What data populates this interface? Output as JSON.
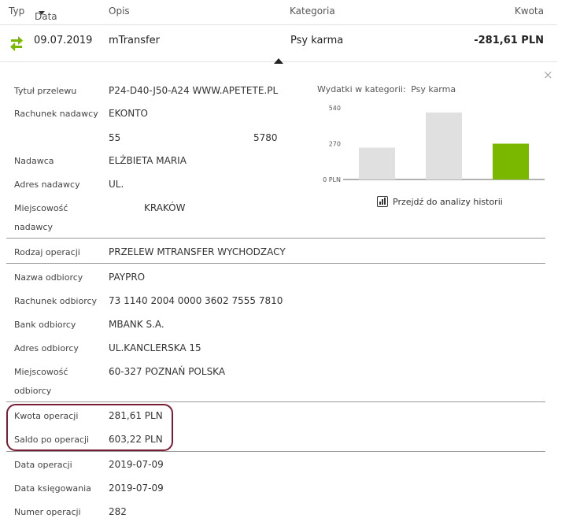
{
  "header": {
    "typ": "Typ",
    "data": "Data",
    "opis": "Opis",
    "kategoria": "Kategoria",
    "kwota": "Kwota"
  },
  "transaction": {
    "date": "09.07.2019",
    "description": "mTransfer",
    "category": "Psy karma",
    "amount": "-281,61 PLN",
    "icon": "transfer-arrows-icon"
  },
  "details": {
    "tytul_label": "Tytuł przelewu",
    "tytul_value": "P24-D40-J50-A24 WWW.APETETE.PL",
    "rachunek_nad_label": "Rachunek nadawcy",
    "rachunek_nad_value": "EKONTO",
    "rachunek_nad_num1": "55",
    "rachunek_nad_num2": "5780",
    "nadawca_label": "Nadawca",
    "nadawca_value": "ELŻBIETA MARIA",
    "adres_nad_label": "Adres nadawcy",
    "adres_nad_value": "UL.",
    "miejsc_nad_label_1": "Miejscowość",
    "miejsc_nad_label_2": "nadawcy",
    "miejsc_nad_value": "KRAKÓW",
    "rodzaj_label": "Rodzaj operacji",
    "rodzaj_value": "PRZELEW MTRANSFER WYCHODZACY",
    "nazwa_odb_label": "Nazwa odbiorcy",
    "nazwa_odb_value": "PAYPRO",
    "rachunek_odb_label": "Rachunek odbiorcy",
    "rachunek_odb_value": "73 1140 2004 0000 3602 7555 7810",
    "bank_odb_label": "Bank odbiorcy",
    "bank_odb_value": "MBANK S.A.",
    "adres_odb_label": "Adres odbiorcy",
    "adres_odb_value": "UL.KANCLERSKA 15",
    "miejsc_odb_label_1": "Miejscowość",
    "miejsc_odb_label_2": "odbiorcy",
    "miejsc_odb_value": "60-327 POZNAŃ POLSKA",
    "kwota_label": "Kwota operacji",
    "kwota_value": "281,61 PLN",
    "saldo_label": "Saldo po operacji",
    "saldo_value": "603,22 PLN",
    "data_op_label": "Data operacji",
    "data_op_value": "2019-07-09",
    "data_ksieg_label": "Data księgowania",
    "data_ksieg_value": "2019-07-09",
    "numer_label": "Numer operacji",
    "numer_value": "282"
  },
  "chart_label": "Wydatki w kategorii:",
  "chart_category": "Psy karma",
  "chart_data": {
    "type": "bar",
    "categories": [
      "",
      "",
      ""
    ],
    "values": [
      240,
      505,
      270
    ],
    "yticks": [
      "0 PLN",
      "270",
      "540"
    ],
    "ylim": [
      0,
      540
    ],
    "colors": [
      "#e0e0e0",
      "#e0e0e0",
      "#7ab800"
    ]
  },
  "history_link": "Przejdź do analizy historii",
  "colors": {
    "accent_green": "#7ab800",
    "highlight": "#7a1c33",
    "bar_gray": "#e0e0e0"
  },
  "close_symbol": "×"
}
